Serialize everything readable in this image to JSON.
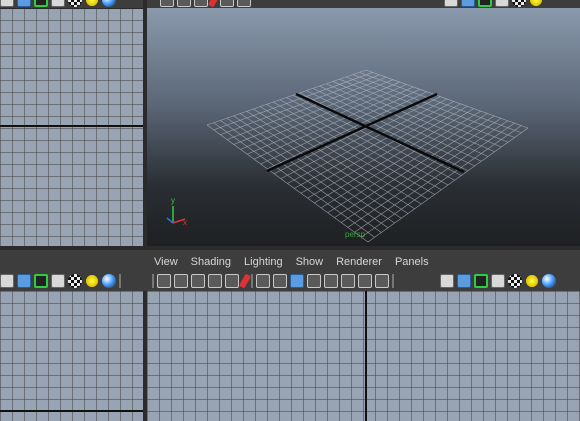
{
  "panel_menu": {
    "items": [
      "View",
      "Shading",
      "Lighting",
      "Show",
      "Renderer",
      "Panels"
    ]
  },
  "viewports": {
    "perspective": {
      "grid_label": "persp",
      "axis_labels": {
        "y": "y",
        "x": "x"
      }
    }
  },
  "colors": {
    "ortho_background": "#98a3b3",
    "perspective_top": "#8a99ad",
    "perspective_bottom": "#1e2022",
    "toolbar_background": "#3d3d3d",
    "selection_highlight": "#2ecc40",
    "menu_text": "#d6d6d6"
  },
  "icons": {
    "top_toolbar": [
      "cube-icon",
      "cube-blue-icon",
      "select-highlight-icon",
      "cube-wire-icon",
      "checker-icon",
      "sun-light-icon",
      "sphere-icon",
      "camera-icon",
      "tool-icon",
      "render-icon",
      "window-icon",
      "grid-icon",
      "panel-icon",
      "cube-icon",
      "cube-blue-icon",
      "select-highlight-icon",
      "cube-wire-icon",
      "checker-icon",
      "sun-light-icon"
    ],
    "bottom_toolbar": [
      "cube-icon",
      "cube-blue-icon",
      "select-highlight-icon",
      "cube-wire-icon",
      "checker-icon",
      "sun-light-icon",
      "sphere-icon",
      "camera-attr-icon",
      "camera-bookmark-icon",
      "image-plane-icon",
      "2d-pan-icon",
      "grease-pencil-icon",
      "paint-icon",
      "grid-toggle-icon",
      "film-gate-icon",
      "resolution-gate-icon",
      "safe-action-icon",
      "isolate-icon",
      "xray-icon",
      "texture-icon",
      "text-icon",
      "cube-icon",
      "cube-blue-icon",
      "select-highlight-icon",
      "cube-wire-icon",
      "checker-icon",
      "sun-light-icon",
      "sphere-icon"
    ]
  }
}
